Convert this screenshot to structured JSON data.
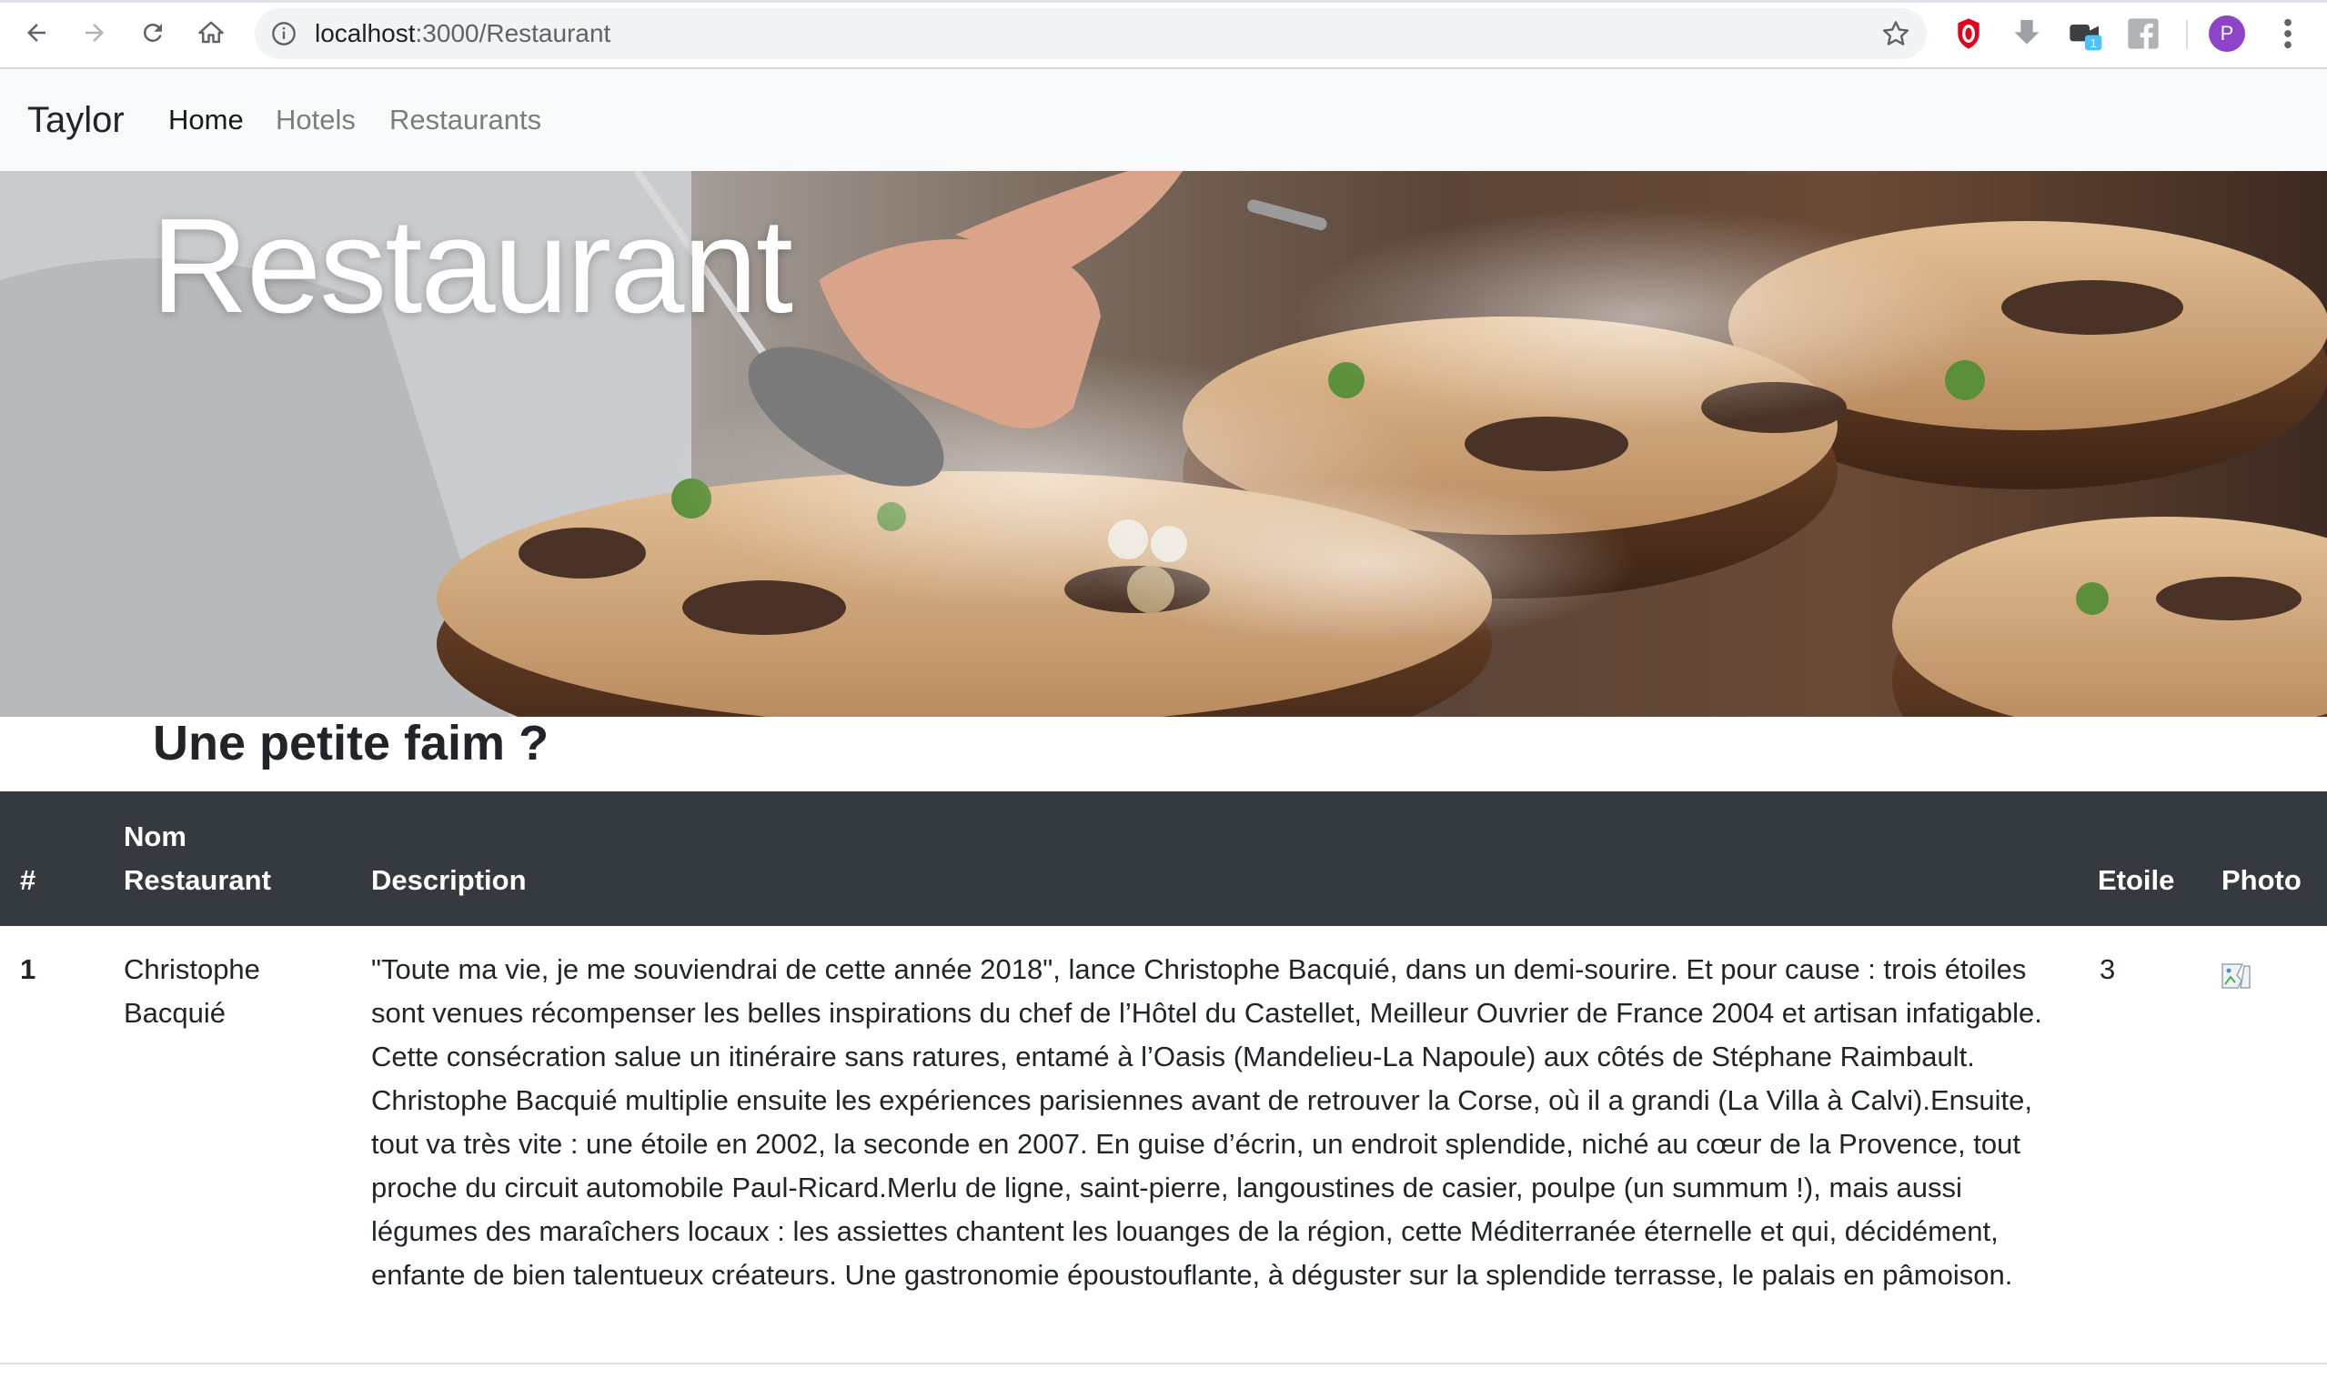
{
  "browser": {
    "url_host": "localhost",
    "url_path": ":3000/Restaurant",
    "extensions": [
      "opera-icon",
      "download-icon",
      "meet-icon",
      "facebook-icon"
    ],
    "extension_badge": "1",
    "profile_initial": "P"
  },
  "navbar": {
    "brand": "Taylor",
    "links": [
      {
        "label": "Home",
        "active": true
      },
      {
        "label": "Hotels",
        "active": false
      },
      {
        "label": "Restaurants",
        "active": false
      }
    ]
  },
  "hero": {
    "title": "Restaurant"
  },
  "section": {
    "subtitle": "Une petite faim ?"
  },
  "table": {
    "headers": {
      "index": "#",
      "name_line1": "Nom",
      "name_line2": "Restaurant",
      "description": "Description",
      "stars": "Etoile",
      "photo": "Photo"
    },
    "rows": [
      {
        "index": "1",
        "name_line1": "Christophe",
        "name_line2": "Bacquié",
        "description": "\"Toute ma vie, je me souviendrai de cette année 2018\", lance Christophe Bacquié, dans un demi-sourire. Et pour cause : trois étoiles sont venues récompenser les belles inspirations du chef de l’Hôtel du Castellet, Meilleur Ouvrier de France 2004 et artisan infatigable. Cette consécration salue un itinéraire sans ratures, entamé à l’Oasis (Mandelieu-La Napoule) aux côtés de Stéphane Raimbault. Christophe Bacquié multiplie ensuite les expériences parisiennes avant de retrouver la Corse, où il a grandi (La Villa à Calvi).Ensuite, tout va très vite : une étoile en 2002, la seconde en 2007. En guise d’écrin, un endroit splendide, niché au cœur de la Provence, tout proche du circuit automobile Paul-Ricard.Merlu de ligne, saint-pierre, langoustines de casier, poulpe (un summum !), mais aussi légumes des maraîchers locaux : les assiettes chantent les louanges de la région, cette Méditerranée éternelle et qui, décidément, enfante de bien talentueux créateurs. Une gastronomie époustouflante, à déguster sur la splendide terrasse, le palais en pâmoison.",
        "stars": "3"
      }
    ]
  }
}
